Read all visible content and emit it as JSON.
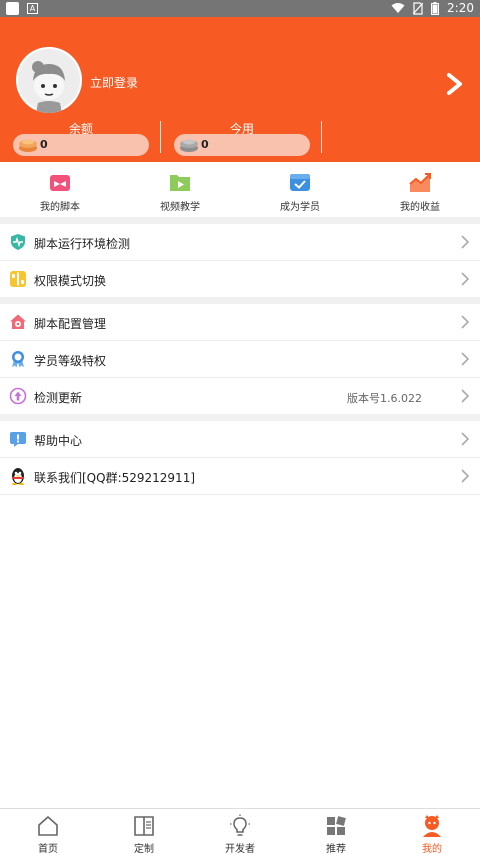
{
  "status_bar": {
    "time": "2:20"
  },
  "header": {
    "login_label": "立即登录",
    "balance_label": "余额",
    "balance_value": "0",
    "today_label": "今用",
    "today_value": "0"
  },
  "quick_actions": [
    {
      "label": "我的脚本",
      "icon": "gift-box-icon",
      "color": "#F2527A"
    },
    {
      "label": "视频教学",
      "icon": "video-folder-icon",
      "color": "#7DC243"
    },
    {
      "label": "成为学员",
      "icon": "checklist-box-icon",
      "color": "#3D8FE0"
    },
    {
      "label": "我的收益",
      "icon": "trend-chart-icon",
      "color": "#F75A22"
    }
  ],
  "menu": [
    {
      "label": "脚本运行环境检测",
      "icon": "shield-pulse-icon"
    },
    {
      "label": "权限模式切换",
      "icon": "toggle-icon"
    },
    {
      "label": "脚本配置管理",
      "icon": "home-config-icon"
    },
    {
      "label": "学员等级特权",
      "icon": "medal-icon"
    },
    {
      "label": "检测更新",
      "icon": "update-icon",
      "extra": "版本号1.6.022"
    },
    {
      "label": "帮助中心",
      "icon": "help-chat-icon"
    },
    {
      "label": "联系我们[QQ群:529212911]",
      "icon": "qq-penguin-icon"
    }
  ],
  "tabs": [
    {
      "label": "首页",
      "icon": "home-icon"
    },
    {
      "label": "定制",
      "icon": "book-icon"
    },
    {
      "label": "开发者",
      "icon": "lightbulb-icon"
    },
    {
      "label": "推荐",
      "icon": "grid-icon"
    },
    {
      "label": "我的",
      "icon": "profile-icon",
      "active": true
    }
  ],
  "colors": {
    "accent": "#F75A22",
    "divider": "#F0F0F0"
  }
}
